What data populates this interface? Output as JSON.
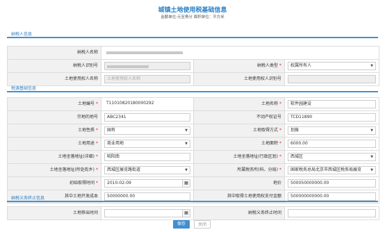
{
  "header": {
    "title": "城镇土地使用税基础信息",
    "subtitle": "金额单位:元至角分  面积单位：平方米"
  },
  "taxpayer": {
    "section_title": "纳税人信息",
    "name_label": "纳税人名称",
    "id_label": "纳税人识别号",
    "type_label": "纳税人类型",
    "type_value": "权属所有人",
    "user_name_label": "土地使用权人名称",
    "user_name_placeholder": "土地使用权人名称",
    "user_id_label": "土地使用权人识别号"
  },
  "tax_source": {
    "section_title": "税源基础信息",
    "land_no_label": "土地编号",
    "land_no_value": "T110108201800002​92",
    "land_name_label": "土地名称",
    "land_name_value": "软件园建设",
    "parcel_label": "宗地的地号",
    "parcel_value": "ABC2341",
    "cert_label": "不动产权证号",
    "cert_value": "TCD11890",
    "nature_label": "土地性质",
    "nature_value": "国有",
    "acquire_label": "土地取得方式",
    "acquire_value": "划拨",
    "use_label": "土地用途",
    "use_value": "商业用地",
    "area_label": "土地面积",
    "area_value": "6000.00",
    "address_label": "土地坐落地址(详细)",
    "address_value": "昭阳南",
    "district_label": "土地坐落地址(行政区划)",
    "district_value": "西城区",
    "street_label": "土地坐落地址(所处街乡)",
    "street_value": "西城区展览路街道",
    "authority_label": "所属税务所(科、分局)",
    "authority_value": "国家税务总局北京市西城区税务局展览",
    "acquired_time_label": "初始取得时间",
    "acquired_time_value": "2010-02-09",
    "price_label": "地价",
    "price_value": "500050000000.00",
    "dev_cost_label": "其中土地开发成本",
    "dev_cost_value": "50000000.00",
    "fee_label": "其中取得土地使用权支付金额",
    "fee_value": "500000000000.00"
  },
  "termination": {
    "section_title": "纳税义务终止信息",
    "exit_time_label": "土地移出时间",
    "end_time_label": "纳税义务终止时间"
  },
  "buttons": {
    "save": "保存",
    "close": "关闭"
  }
}
